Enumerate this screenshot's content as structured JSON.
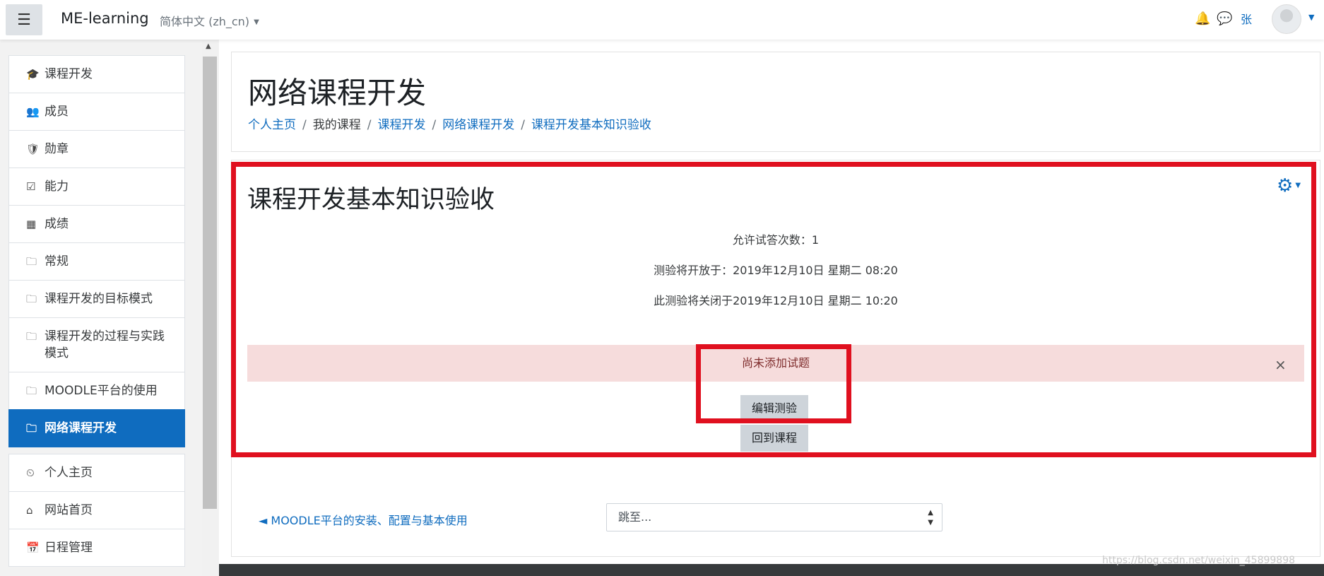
{
  "navbar": {
    "menu_icon": "☰",
    "brand": "ME-learning",
    "language": "简体中文 (zh_cn)",
    "username": "张",
    "colors": {
      "accent": "#0f6cbf"
    }
  },
  "sidebar": {
    "items": [
      {
        "icon": "🎓",
        "label": "课程开发"
      },
      {
        "icon": "👥",
        "label": "成员"
      },
      {
        "icon": "🛡",
        "label": "勋章"
      },
      {
        "icon": "☑",
        "label": "能力"
      },
      {
        "icon": "▦",
        "label": "成绩"
      },
      {
        "icon": "🗀",
        "label": "常规"
      },
      {
        "icon": "🗀",
        "label": "课程开发的目标模式"
      },
      {
        "icon": "🗀",
        "label": "课程开发的过程与实践模式"
      },
      {
        "icon": "🗀",
        "label": "MOODLE平台的使用"
      },
      {
        "icon": "🗀",
        "label": "网络课程开发"
      }
    ],
    "items2": [
      {
        "icon": "⏲",
        "label": "个人主页"
      },
      {
        "icon": "⌂",
        "label": "网站首页"
      },
      {
        "icon": "📅",
        "label": "日程管理"
      }
    ]
  },
  "header": {
    "title": "网络课程开发",
    "breadcrumb": [
      "个人主页",
      "我的课程",
      "课程开发",
      "网络课程开发",
      "课程开发基本知识验收"
    ]
  },
  "quiz": {
    "title": "课程开发基本知识验收",
    "attempts": "允许试答次数：1",
    "opens": "测验将开放于：2019年12月10日 星期二 08:20",
    "closes": "此测验将关闭于2019年12月10日 星期二 10:20",
    "alert": "尚未添加试题",
    "alert_close": "×",
    "edit_button": "编辑测验",
    "back_button": "回到课程"
  },
  "bottom": {
    "prev_link": "◄ MOODLE平台的安装、配置与基本使用",
    "jump_placeholder": "跳至..."
  },
  "watermark": "https://blog.csdn.net/weixin_45899898"
}
